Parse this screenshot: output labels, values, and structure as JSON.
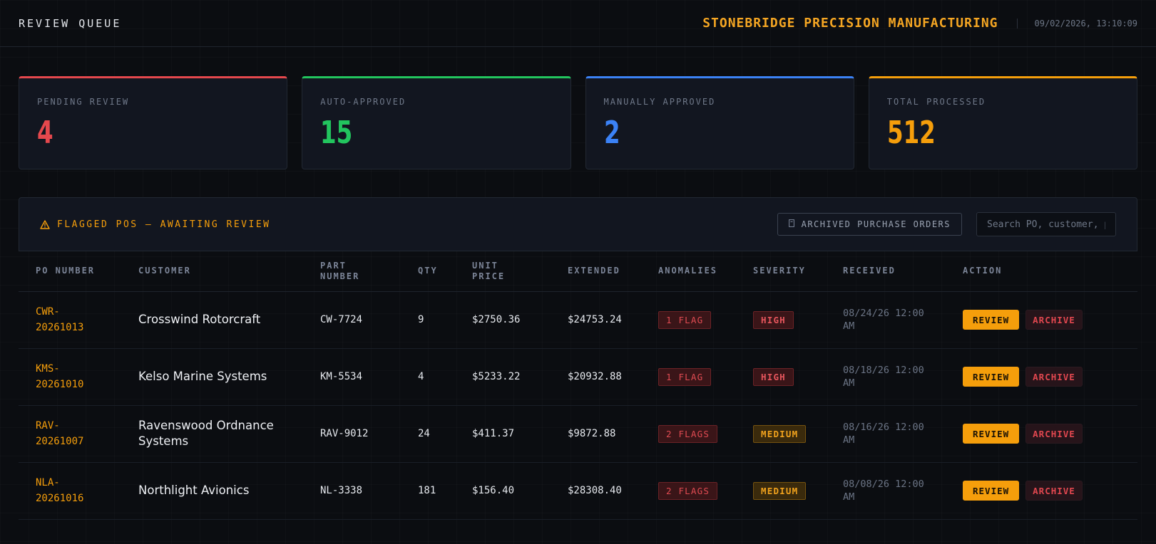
{
  "header": {
    "title": "REVIEW QUEUE",
    "company": "STONEBRIDGE PRECISION MANUFACTURING",
    "datetime": "09/02/2026, 13:10:09"
  },
  "stats": [
    {
      "label": "PENDING REVIEW",
      "value": "4",
      "color": "#e5484d"
    },
    {
      "label": "AUTO-APPROVED",
      "value": "15",
      "color": "#22c55e"
    },
    {
      "label": "MANUALLY APPROVED",
      "value": "2",
      "color": "#3b82f6"
    },
    {
      "label": "TOTAL PROCESSED",
      "value": "512",
      "color": "#f59e0b"
    }
  ],
  "panel": {
    "title": "FLAGGED POS — AWAITING REVIEW",
    "archived_button": "ARCHIVED PURCHASE ORDERS",
    "search_placeholder": "Search PO, customer, part..."
  },
  "table": {
    "columns": [
      "PO NUMBER",
      "CUSTOMER",
      "PART NUMBER",
      "QTY",
      "UNIT PRICE",
      "EXTENDED",
      "ANOMALIES",
      "SEVERITY",
      "RECEIVED",
      "ACTION"
    ],
    "rows": [
      {
        "po": "CWR-20261013",
        "customer": "Crosswind Rotorcraft",
        "part": "CW-7724",
        "qty": "9",
        "unit_price": "$2750.36",
        "extended": "$24753.24",
        "anomalies": "1 FLAG",
        "severity": "HIGH",
        "received": "08/24/26 12:00 AM",
        "review": "REVIEW",
        "archive": "ARCHIVE"
      },
      {
        "po": "KMS-20261010",
        "customer": "Kelso Marine Systems",
        "part": "KM-5534",
        "qty": "4",
        "unit_price": "$5233.22",
        "extended": "$20932.88",
        "anomalies": "1 FLAG",
        "severity": "HIGH",
        "received": "08/18/26 12:00 AM",
        "review": "REVIEW",
        "archive": "ARCHIVE"
      },
      {
        "po": "RAV-20261007",
        "customer": "Ravenswood Ordnance Systems",
        "part": "RAV-9012",
        "qty": "24",
        "unit_price": "$411.37",
        "extended": "$9872.88",
        "anomalies": "2 FLAGS",
        "severity": "MEDIUM",
        "received": "08/16/26 12:00 AM",
        "review": "REVIEW",
        "archive": "ARCHIVE"
      },
      {
        "po": "NLA-20261016",
        "customer": "Northlight Avionics",
        "part": "NL-3338",
        "qty": "181",
        "unit_price": "$156.40",
        "extended": "$28308.40",
        "anomalies": "2 FLAGS",
        "severity": "MEDIUM",
        "received": "08/08/26 12:00 AM",
        "review": "REVIEW",
        "archive": "ARCHIVE"
      }
    ]
  }
}
